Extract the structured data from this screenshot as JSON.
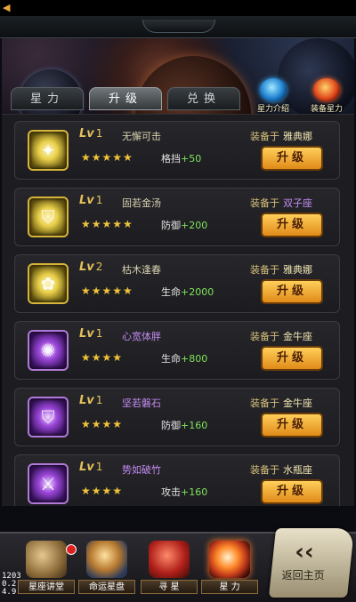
{
  "tabs": [
    {
      "label": "星力",
      "active": false
    },
    {
      "label": "升级",
      "active": true
    },
    {
      "label": "兑换",
      "active": false
    }
  ],
  "side_buttons": [
    {
      "label": "星力介绍",
      "icon": "constellation-icon"
    },
    {
      "label": "装备星力",
      "icon": "equip-star-icon"
    }
  ],
  "items": [
    {
      "level_prefix": "Lv",
      "level": "1",
      "name": "无懈可击",
      "rarity": "gold",
      "stars": "★★★★★",
      "stat_name": "格挡",
      "stat_value": "+50",
      "equip_prefix": "装备于",
      "equip_target": "雅典娜",
      "button": "升级"
    },
    {
      "level_prefix": "Lv",
      "level": "1",
      "name": "固若金汤",
      "rarity": "gold",
      "stars": "★★★★★",
      "stat_name": "防御",
      "stat_value": "+200",
      "equip_prefix": "装备于",
      "equip_target": "双子座",
      "button": "升级"
    },
    {
      "level_prefix": "Lv",
      "level": "2",
      "name": "枯木逢春",
      "rarity": "gold",
      "stars": "★★★★★",
      "stat_name": "生命",
      "stat_value": "+2000",
      "equip_prefix": "装备于",
      "equip_target": "雅典娜",
      "button": "升级"
    },
    {
      "level_prefix": "Lv",
      "level": "1",
      "name": "心宽体胖",
      "rarity": "purple",
      "stars": "★★★★",
      "stat_name": "生命",
      "stat_value": "+800",
      "equip_prefix": "装备于",
      "equip_target": "金牛座",
      "button": "升级"
    },
    {
      "level_prefix": "Lv",
      "level": "1",
      "name": "坚若磐石",
      "rarity": "purple",
      "stars": "★★★★",
      "stat_name": "防御",
      "stat_value": "+160",
      "equip_prefix": "装备于",
      "equip_target": "金牛座",
      "button": "升级"
    },
    {
      "level_prefix": "Lv",
      "level": "1",
      "name": "势如破竹",
      "rarity": "purple",
      "stars": "★★★★",
      "stat_name": "攻击",
      "stat_value": "+160",
      "equip_prefix": "装备于",
      "equip_target": "水瓶座",
      "button": "升级"
    }
  ],
  "bottom_nav": [
    {
      "label": "星座讲堂",
      "icon": "book-icon",
      "badge": true
    },
    {
      "label": "命运星盘",
      "icon": "star-plate-icon",
      "badge": false
    },
    {
      "label": "寻 星",
      "icon": "tome-icon",
      "badge": false
    },
    {
      "label": "星 力",
      "icon": "star-power-icon",
      "badge": false
    }
  ],
  "back_button": {
    "chevron": "‹‹",
    "label": "返回主页"
  },
  "debug": {
    "line1": "1203",
    "line2": "0.2",
    "line3": "4.9"
  },
  "colors": {
    "accent_gold": "#e3c25a",
    "stat_green": "#7fe35a",
    "purple_name": "#c58cf2",
    "button_orange": "#f0a830"
  }
}
